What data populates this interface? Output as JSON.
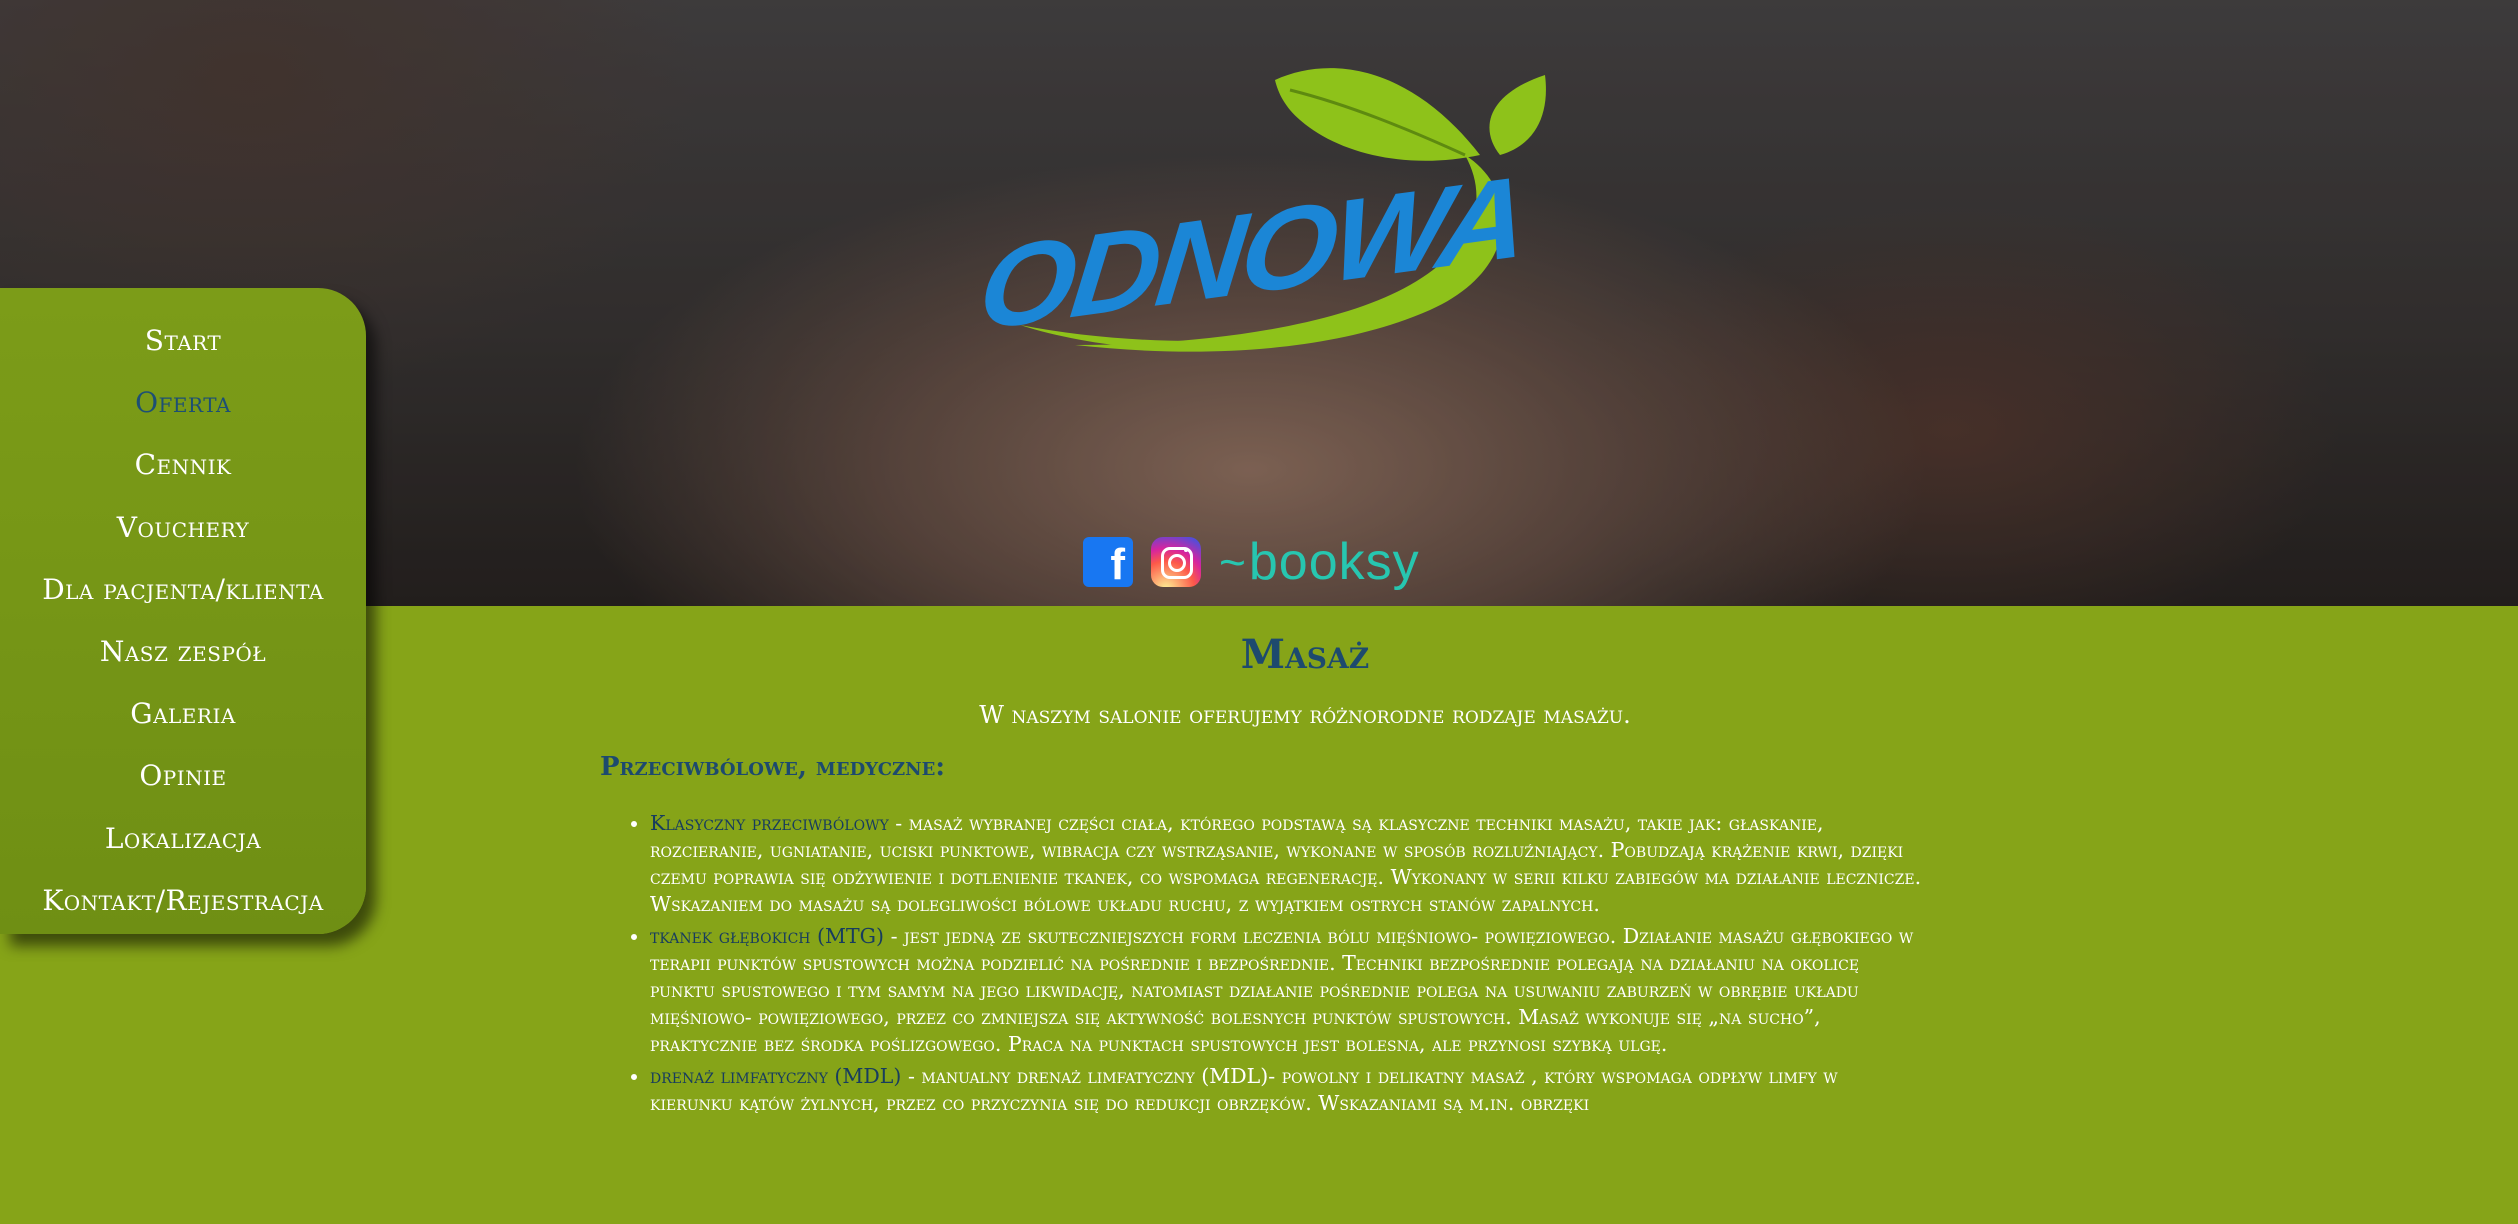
{
  "brand": {
    "name": "ODNOWA",
    "colors": {
      "green": "#8ec21a",
      "blue": "#1b86d6",
      "nav_active": "#1d4f74",
      "bg": "#86a418"
    }
  },
  "socials": [
    {
      "name": "facebook-icon",
      "glyph": "f"
    },
    {
      "name": "instagram-icon"
    },
    {
      "name": "booksy",
      "label": "booksy",
      "glyph": "~"
    }
  ],
  "nav": {
    "items": [
      {
        "label": "Start",
        "active": false
      },
      {
        "label": "Oferta",
        "active": true
      },
      {
        "label": "Cennik",
        "active": false
      },
      {
        "label": "Vouchery",
        "active": false
      },
      {
        "label": "Dla pacjenta/klienta",
        "active": false
      },
      {
        "label": "Nasz zespół",
        "active": false
      },
      {
        "label": "Galeria",
        "active": false
      },
      {
        "label": "Opinie",
        "active": false
      },
      {
        "label": "Lokalizacja",
        "active": false
      },
      {
        "label": "Kontakt/Rejestracja",
        "active": false
      }
    ]
  },
  "main": {
    "title": "Masaż",
    "intro": "W naszym salonie oferujemy różnorodne rodzaje masażu.",
    "section_heading": "Przeciwbólowe, medyczne:",
    "items": [
      {
        "term": "Klasyczny przeciwbólowy",
        "text": " - masaż wybranej części ciała, którego podstawą są klasyczne techniki masażu, takie jak: głaskanie, rozcieranie, ugniatanie, uciski punktowe, wibracja czy wstrząsanie, wykonane w sposób rozluźniający. Pobudzają krążenie krwi, dzięki czemu poprawia się odżywienie i dotlenienie tkanek, co wspomaga regenerację. Wykonany w serii kilku zabiegów ma działanie lecznicze. Wskazaniem do masażu są dolegliwości bólowe układu ruchu, z wyjątkiem ostrych stanów zapalnych."
      },
      {
        "term": "tkanek głębokich (MTG)",
        "text": " - jest jedną ze skuteczniejszych form leczenia bólu mięśniowo- powięziowego. Działanie masażu głębokiego w terapii punktów spustowych można podzielić na pośrednie i bezpośrednie. Techniki bezpośrednie polegają na działaniu na okolicę punktu spustowego i tym samym na jego likwidację, natomiast działanie pośrednie polega na usuwaniu zaburzeń w obrębie układu mięśniowo- powięziowego, przez co zmniejsza się aktywność bolesnych punktów spustowych. Masaż wykonuje się „na sucho”, praktycznie bez środka poślizgowego. Praca na punktach spustowych jest bolesna, ale przynosi szybką ulgę."
      },
      {
        "term": "drenaż limfatyczny (MDL)",
        "text": " - manualny drenaż limfatyczny (MDL)- powolny i delikatny masaż , który wspomaga odpływ limfy w kierunku kątów żylnych, przez co przyczynia się do redukcji obrzęków. Wskazaniami są m.in. obrzęki"
      }
    ]
  }
}
